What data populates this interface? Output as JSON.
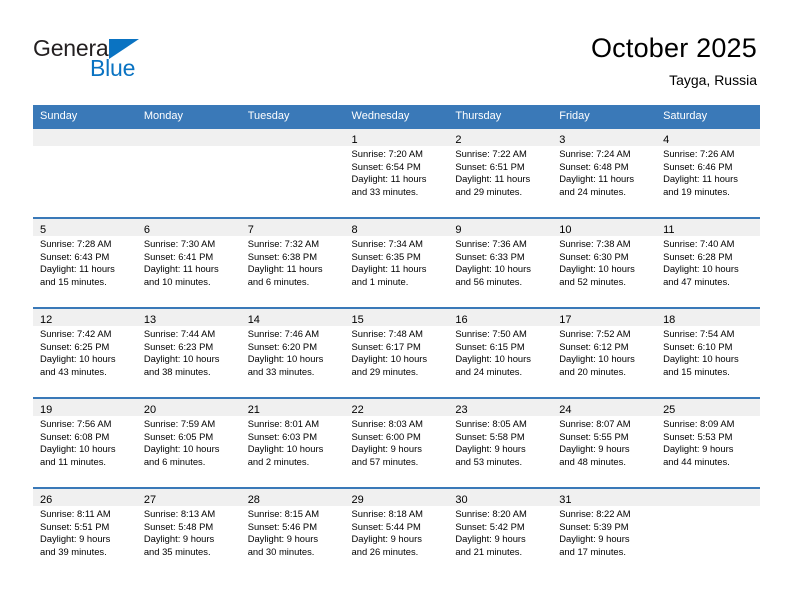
{
  "brand": {
    "name_top": "General",
    "name_bottom": "Blue",
    "color_blue": "#0a73c2",
    "color_dark": "#231f20",
    "triangle_icon": "triangle-icon"
  },
  "header": {
    "title": "October 2025",
    "subtitle": "Tayga, Russia"
  },
  "theme": {
    "header_blue": "#3a79b8",
    "daynum_band": "#f0f0f0",
    "text": "#000000"
  },
  "weekdays": [
    "Sunday",
    "Monday",
    "Tuesday",
    "Wednesday",
    "Thursday",
    "Friday",
    "Saturday"
  ],
  "weeks": [
    [
      {
        "day": "",
        "sunrise": "",
        "sunset": "",
        "daylight1": "",
        "daylight2": ""
      },
      {
        "day": "",
        "sunrise": "",
        "sunset": "",
        "daylight1": "",
        "daylight2": ""
      },
      {
        "day": "",
        "sunrise": "",
        "sunset": "",
        "daylight1": "",
        "daylight2": ""
      },
      {
        "day": "1",
        "sunrise": "Sunrise: 7:20 AM",
        "sunset": "Sunset: 6:54 PM",
        "daylight1": "Daylight: 11 hours",
        "daylight2": "and 33 minutes."
      },
      {
        "day": "2",
        "sunrise": "Sunrise: 7:22 AM",
        "sunset": "Sunset: 6:51 PM",
        "daylight1": "Daylight: 11 hours",
        "daylight2": "and 29 minutes."
      },
      {
        "day": "3",
        "sunrise": "Sunrise: 7:24 AM",
        "sunset": "Sunset: 6:48 PM",
        "daylight1": "Daylight: 11 hours",
        "daylight2": "and 24 minutes."
      },
      {
        "day": "4",
        "sunrise": "Sunrise: 7:26 AM",
        "sunset": "Sunset: 6:46 PM",
        "daylight1": "Daylight: 11 hours",
        "daylight2": "and 19 minutes."
      }
    ],
    [
      {
        "day": "5",
        "sunrise": "Sunrise: 7:28 AM",
        "sunset": "Sunset: 6:43 PM",
        "daylight1": "Daylight: 11 hours",
        "daylight2": "and 15 minutes."
      },
      {
        "day": "6",
        "sunrise": "Sunrise: 7:30 AM",
        "sunset": "Sunset: 6:41 PM",
        "daylight1": "Daylight: 11 hours",
        "daylight2": "and 10 minutes."
      },
      {
        "day": "7",
        "sunrise": "Sunrise: 7:32 AM",
        "sunset": "Sunset: 6:38 PM",
        "daylight1": "Daylight: 11 hours",
        "daylight2": "and 6 minutes."
      },
      {
        "day": "8",
        "sunrise": "Sunrise: 7:34 AM",
        "sunset": "Sunset: 6:35 PM",
        "daylight1": "Daylight: 11 hours",
        "daylight2": "and 1 minute."
      },
      {
        "day": "9",
        "sunrise": "Sunrise: 7:36 AM",
        "sunset": "Sunset: 6:33 PM",
        "daylight1": "Daylight: 10 hours",
        "daylight2": "and 56 minutes."
      },
      {
        "day": "10",
        "sunrise": "Sunrise: 7:38 AM",
        "sunset": "Sunset: 6:30 PM",
        "daylight1": "Daylight: 10 hours",
        "daylight2": "and 52 minutes."
      },
      {
        "day": "11",
        "sunrise": "Sunrise: 7:40 AM",
        "sunset": "Sunset: 6:28 PM",
        "daylight1": "Daylight: 10 hours",
        "daylight2": "and 47 minutes."
      }
    ],
    [
      {
        "day": "12",
        "sunrise": "Sunrise: 7:42 AM",
        "sunset": "Sunset: 6:25 PM",
        "daylight1": "Daylight: 10 hours",
        "daylight2": "and 43 minutes."
      },
      {
        "day": "13",
        "sunrise": "Sunrise: 7:44 AM",
        "sunset": "Sunset: 6:23 PM",
        "daylight1": "Daylight: 10 hours",
        "daylight2": "and 38 minutes."
      },
      {
        "day": "14",
        "sunrise": "Sunrise: 7:46 AM",
        "sunset": "Sunset: 6:20 PM",
        "daylight1": "Daylight: 10 hours",
        "daylight2": "and 33 minutes."
      },
      {
        "day": "15",
        "sunrise": "Sunrise: 7:48 AM",
        "sunset": "Sunset: 6:17 PM",
        "daylight1": "Daylight: 10 hours",
        "daylight2": "and 29 minutes."
      },
      {
        "day": "16",
        "sunrise": "Sunrise: 7:50 AM",
        "sunset": "Sunset: 6:15 PM",
        "daylight1": "Daylight: 10 hours",
        "daylight2": "and 24 minutes."
      },
      {
        "day": "17",
        "sunrise": "Sunrise: 7:52 AM",
        "sunset": "Sunset: 6:12 PM",
        "daylight1": "Daylight: 10 hours",
        "daylight2": "and 20 minutes."
      },
      {
        "day": "18",
        "sunrise": "Sunrise: 7:54 AM",
        "sunset": "Sunset: 6:10 PM",
        "daylight1": "Daylight: 10 hours",
        "daylight2": "and 15 minutes."
      }
    ],
    [
      {
        "day": "19",
        "sunrise": "Sunrise: 7:56 AM",
        "sunset": "Sunset: 6:08 PM",
        "daylight1": "Daylight: 10 hours",
        "daylight2": "and 11 minutes."
      },
      {
        "day": "20",
        "sunrise": "Sunrise: 7:59 AM",
        "sunset": "Sunset: 6:05 PM",
        "daylight1": "Daylight: 10 hours",
        "daylight2": "and 6 minutes."
      },
      {
        "day": "21",
        "sunrise": "Sunrise: 8:01 AM",
        "sunset": "Sunset: 6:03 PM",
        "daylight1": "Daylight: 10 hours",
        "daylight2": "and 2 minutes."
      },
      {
        "day": "22",
        "sunrise": "Sunrise: 8:03 AM",
        "sunset": "Sunset: 6:00 PM",
        "daylight1": "Daylight: 9 hours",
        "daylight2": "and 57 minutes."
      },
      {
        "day": "23",
        "sunrise": "Sunrise: 8:05 AM",
        "sunset": "Sunset: 5:58 PM",
        "daylight1": "Daylight: 9 hours",
        "daylight2": "and 53 minutes."
      },
      {
        "day": "24",
        "sunrise": "Sunrise: 8:07 AM",
        "sunset": "Sunset: 5:55 PM",
        "daylight1": "Daylight: 9 hours",
        "daylight2": "and 48 minutes."
      },
      {
        "day": "25",
        "sunrise": "Sunrise: 8:09 AM",
        "sunset": "Sunset: 5:53 PM",
        "daylight1": "Daylight: 9 hours",
        "daylight2": "and 44 minutes."
      }
    ],
    [
      {
        "day": "26",
        "sunrise": "Sunrise: 8:11 AM",
        "sunset": "Sunset: 5:51 PM",
        "daylight1": "Daylight: 9 hours",
        "daylight2": "and 39 minutes."
      },
      {
        "day": "27",
        "sunrise": "Sunrise: 8:13 AM",
        "sunset": "Sunset: 5:48 PM",
        "daylight1": "Daylight: 9 hours",
        "daylight2": "and 35 minutes."
      },
      {
        "day": "28",
        "sunrise": "Sunrise: 8:15 AM",
        "sunset": "Sunset: 5:46 PM",
        "daylight1": "Daylight: 9 hours",
        "daylight2": "and 30 minutes."
      },
      {
        "day": "29",
        "sunrise": "Sunrise: 8:18 AM",
        "sunset": "Sunset: 5:44 PM",
        "daylight1": "Daylight: 9 hours",
        "daylight2": "and 26 minutes."
      },
      {
        "day": "30",
        "sunrise": "Sunrise: 8:20 AM",
        "sunset": "Sunset: 5:42 PM",
        "daylight1": "Daylight: 9 hours",
        "daylight2": "and 21 minutes."
      },
      {
        "day": "31",
        "sunrise": "Sunrise: 8:22 AM",
        "sunset": "Sunset: 5:39 PM",
        "daylight1": "Daylight: 9 hours",
        "daylight2": "and 17 minutes."
      },
      {
        "day": "",
        "sunrise": "",
        "sunset": "",
        "daylight1": "",
        "daylight2": ""
      }
    ]
  ]
}
